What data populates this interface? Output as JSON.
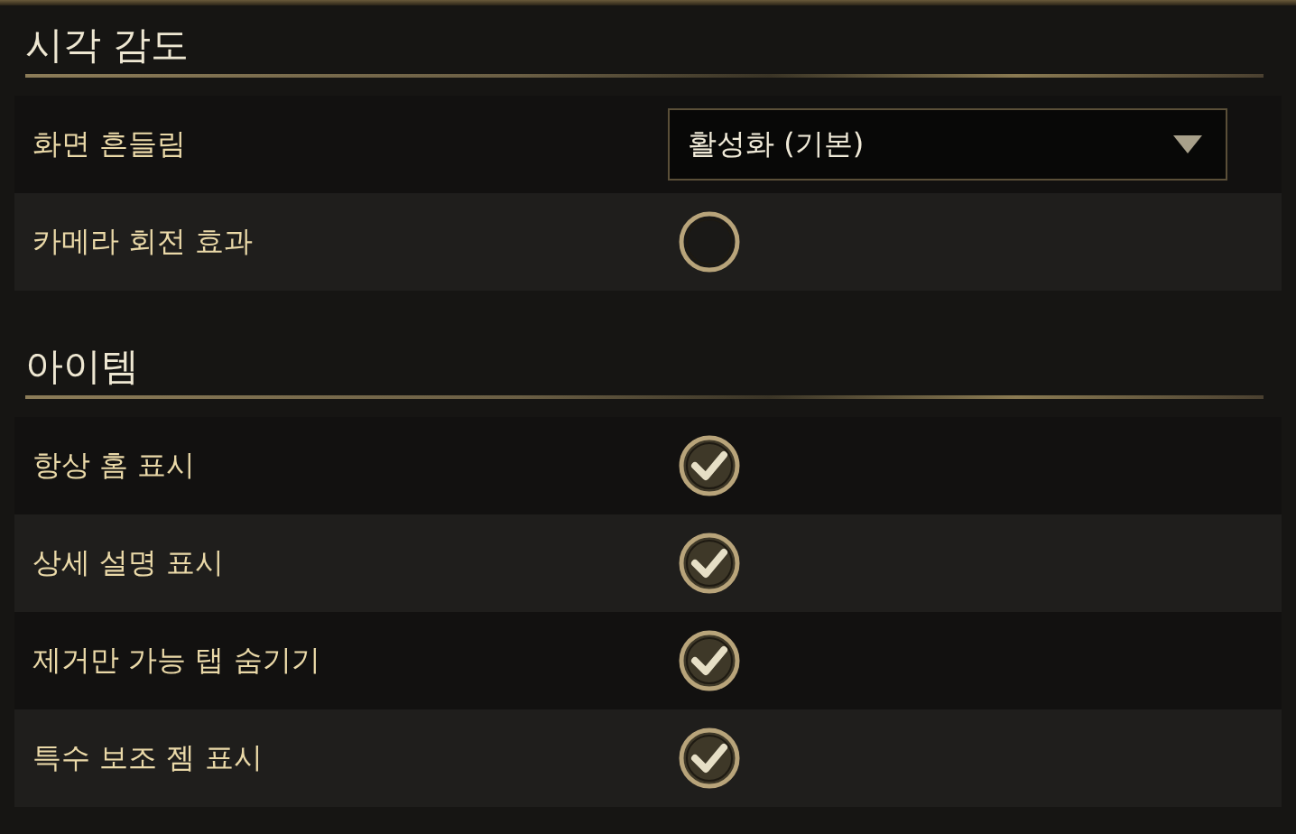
{
  "sections": [
    {
      "title": "시각 감도",
      "rows": [
        {
          "kind": "dropdown",
          "label": "화면 흔들림",
          "value": "활성화 (기본)"
        },
        {
          "kind": "checkbox",
          "label": "카메라 회전 효과",
          "checked": false
        }
      ]
    },
    {
      "title": "아이템",
      "rows": [
        {
          "kind": "checkbox",
          "label": "항상 홈 표시",
          "checked": true
        },
        {
          "kind": "checkbox",
          "label": "상세 설명 표시",
          "checked": true
        },
        {
          "kind": "checkbox",
          "label": "제거만 가능 탭 숨기기",
          "checked": true
        },
        {
          "kind": "checkbox",
          "label": "특수 보조 젬 표시",
          "checked": true
        }
      ]
    }
  ]
}
